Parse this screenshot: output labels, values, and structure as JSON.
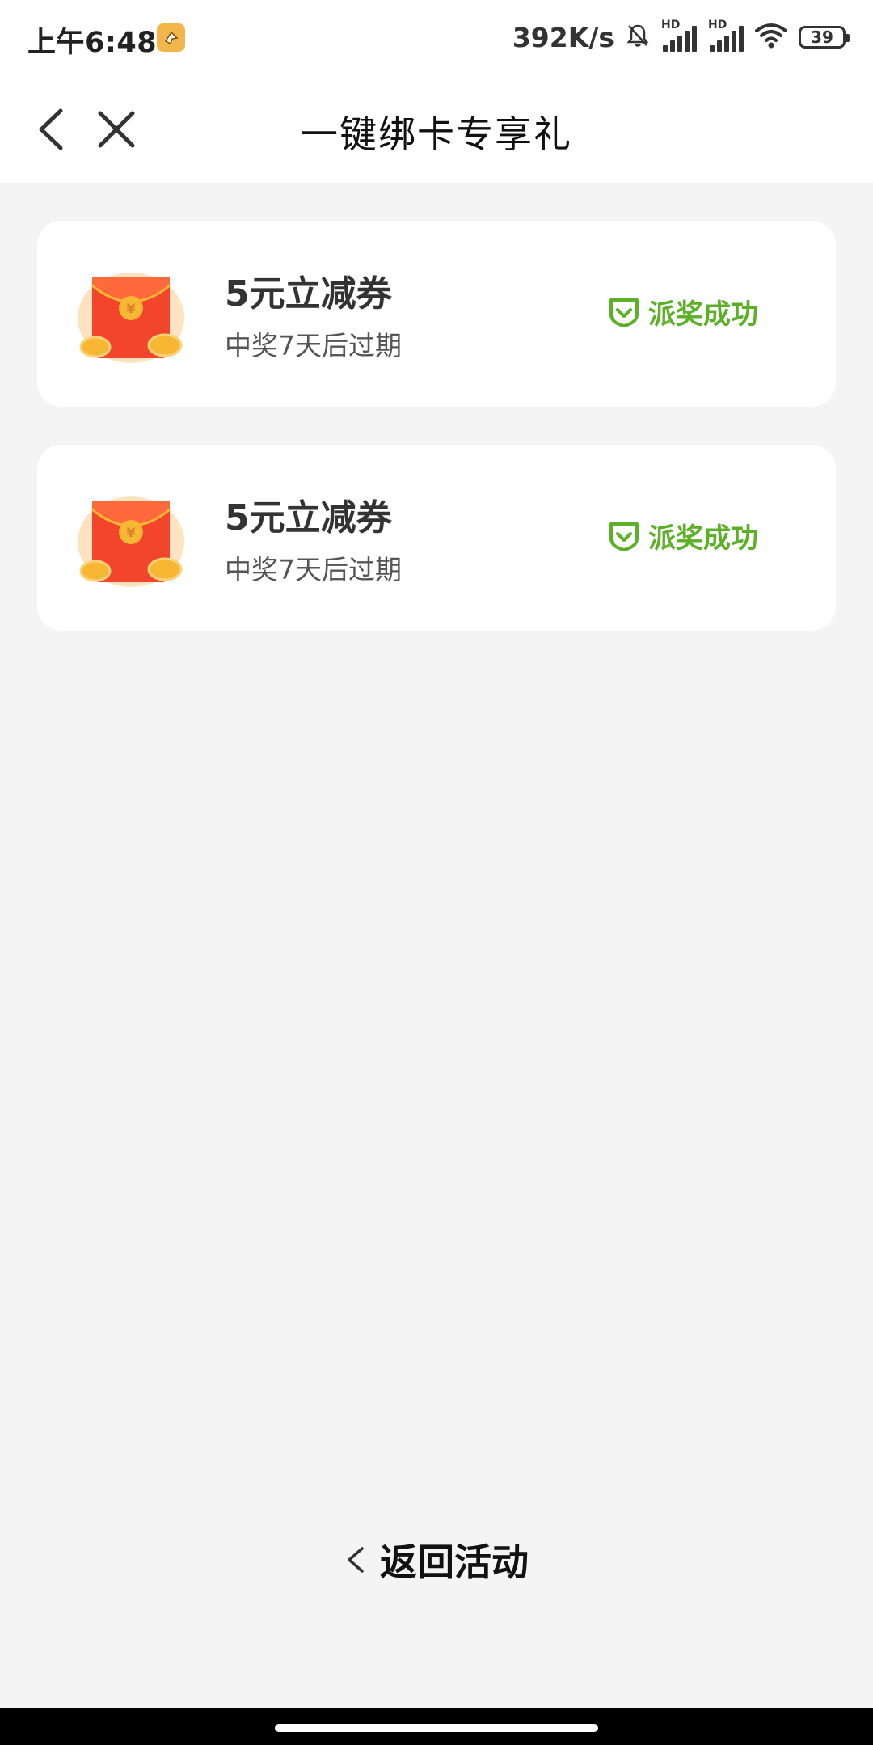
{
  "status_bar": {
    "time": "上午6:48",
    "net_speed": "392K/s",
    "signal_label_1": "HD",
    "signal_label_2": "HD",
    "battery": "39"
  },
  "header": {
    "title": "一键绑卡专享礼"
  },
  "rewards": [
    {
      "title": "5元立减券",
      "subtitle": "中奖7天后过期",
      "status": "派奖成功"
    },
    {
      "title": "5元立减券",
      "subtitle": "中奖7天后过期",
      "status": "派奖成功"
    }
  ],
  "footer": {
    "back_label": "返回活动"
  },
  "colors": {
    "success_green": "#5bb025",
    "envelope_red": "#f2452b",
    "coin_gold": "#f7b733",
    "page_bg": "#f4f4f4"
  }
}
